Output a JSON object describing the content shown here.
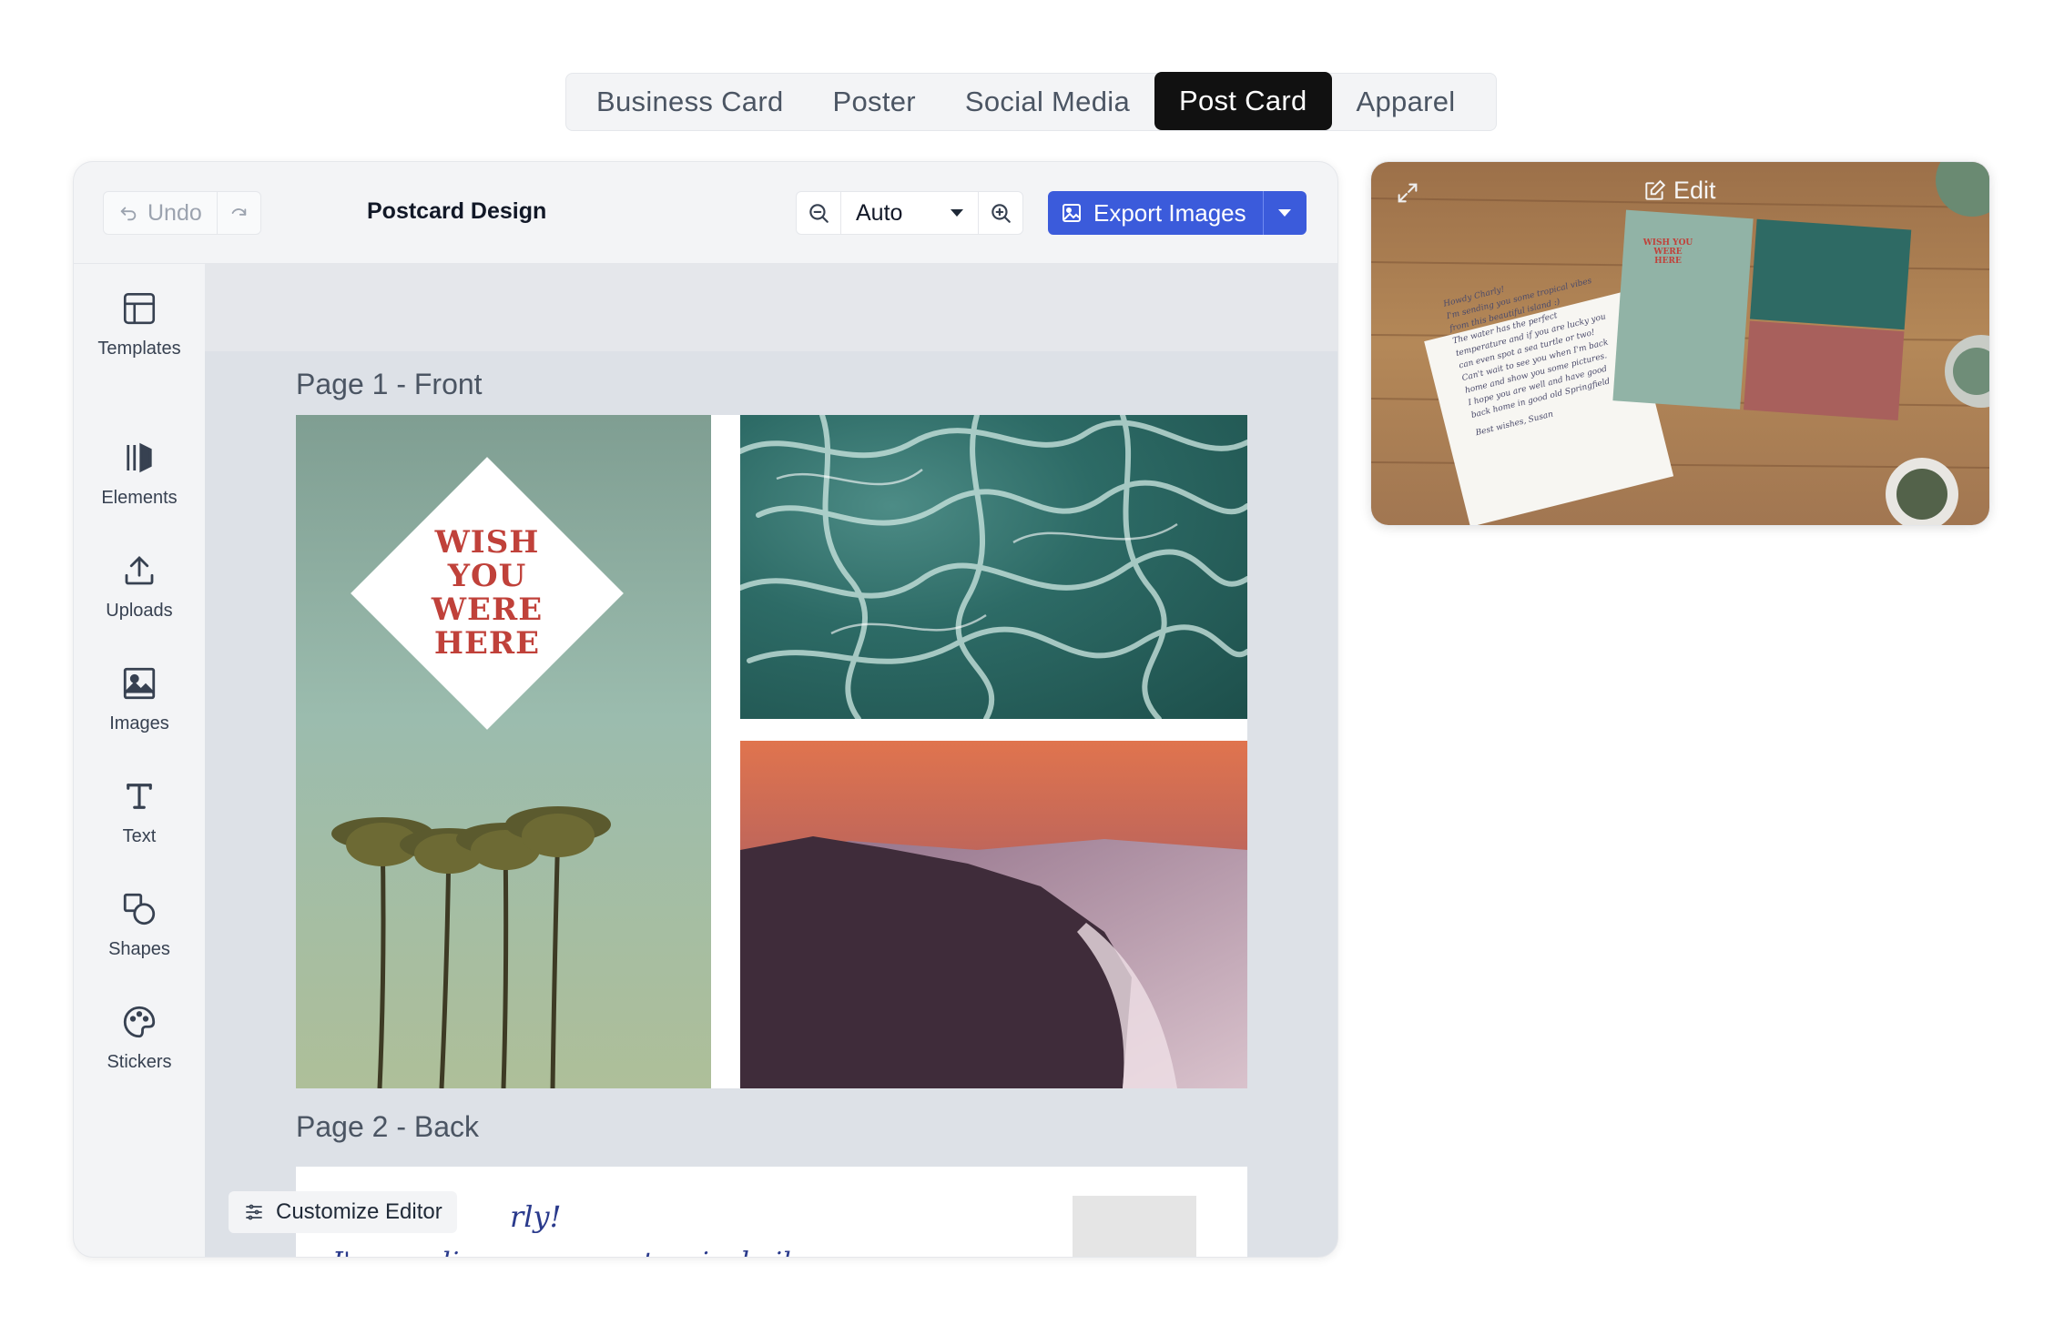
{
  "tabs": [
    {
      "label": "Business Card",
      "active": false
    },
    {
      "label": "Poster",
      "active": false
    },
    {
      "label": "Social Media",
      "active": false
    },
    {
      "label": "Post Card",
      "active": true
    },
    {
      "label": "Apparel",
      "active": false
    }
  ],
  "toolbar": {
    "undo_label": "Undo",
    "title": "Postcard Design",
    "zoom_value": "Auto",
    "export_label": "Export Images"
  },
  "sidebar": {
    "items": [
      {
        "label": "Templates",
        "icon": "templates-icon"
      },
      {
        "label": "Elements",
        "icon": "elements-icon"
      },
      {
        "label": "Uploads",
        "icon": "upload-icon"
      },
      {
        "label": "Images",
        "icon": "image-icon"
      },
      {
        "label": "Text",
        "icon": "text-icon"
      },
      {
        "label": "Shapes",
        "icon": "shapes-icon"
      },
      {
        "label": "Stickers",
        "icon": "sticker-icon"
      }
    ]
  },
  "canvas": {
    "page1_label": "Page 1 - Front",
    "page2_label": "Page 2 - Back",
    "front_text_lines": [
      "WISH",
      "YOU",
      "WERE",
      "HERE"
    ],
    "back_greeting_partial": "rly!",
    "back_line_partial": "I'm sending you some tropical vibes"
  },
  "customize_label": "Customize Editor",
  "preview": {
    "edit_label": "Edit",
    "wish_text": "WISH YOU WERE HERE",
    "letter_lines": [
      "Howdy Charly!",
      "I'm sending you some tropical vibes",
      "from this beautiful island :)",
      "The water has the perfect",
      "temperature and if you are lucky you",
      "can even spot a sea turtle or two!",
      "Can't wait to see you when I'm back",
      "home and show you some pictures.",
      "I hope you are well and have good",
      "back home in good old Springfield",
      "Best wishes, Susan"
    ]
  },
  "colors": {
    "active_tab": "#111111",
    "export_button": "#3b5bdb",
    "wish_text": "#c0413a",
    "script_text": "#2a3a8c"
  }
}
